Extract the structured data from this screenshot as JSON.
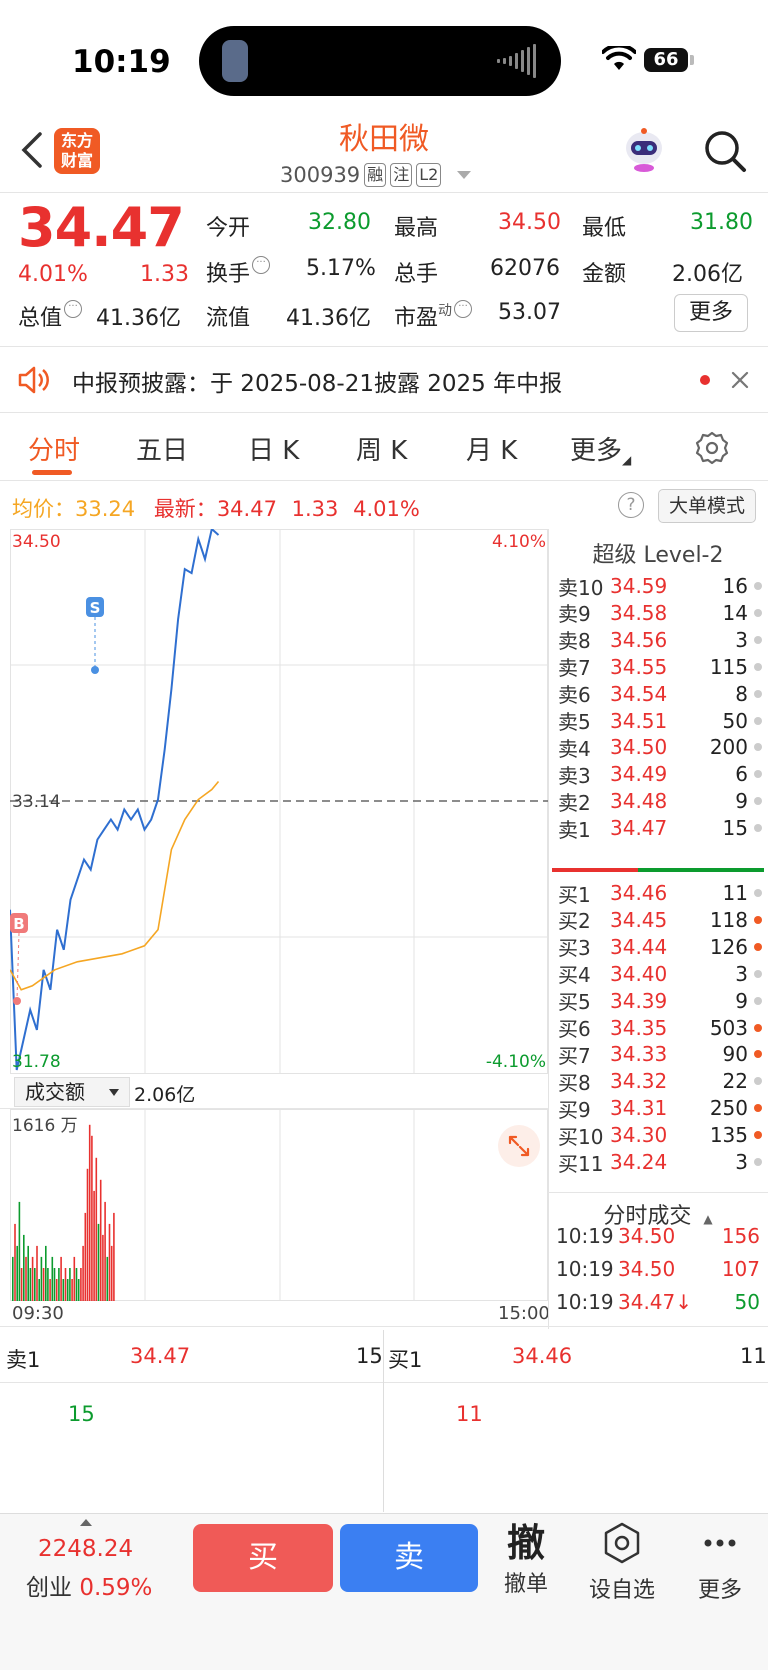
{
  "status": {
    "time": "10:19",
    "battery": "66"
  },
  "header": {
    "logo_line1": "东方",
    "logo_line2": "财富",
    "stock_name": "秋田微",
    "stock_code": "300939",
    "tags": [
      "融",
      "注",
      "L2"
    ]
  },
  "quote": {
    "price": "34.47",
    "change_pct": "4.01%",
    "change": "1.33",
    "open_label": "今开",
    "open": "32.80",
    "high_label": "最高",
    "high": "34.50",
    "low_label": "最低",
    "low": "31.80",
    "turnover_label": "换手",
    "turnover": "5.17%",
    "volume_label": "总手",
    "volume": "62076",
    "amount_label": "金额",
    "amount": "2.06亿",
    "mktcap_label": "总值",
    "mktcap": "41.36亿",
    "float_label": "流值",
    "float": "41.36亿",
    "pe_label": "市盈",
    "pe_sup": "动",
    "pe": "53.07",
    "more": "更多"
  },
  "notice": {
    "text": "中报预披露：于 2025-08-21披露 2025 年中报"
  },
  "tabs": [
    "分时",
    "五日",
    "日 K",
    "周 K",
    "月 K",
    "更多"
  ],
  "avg_row": {
    "avg_label": "均价：",
    "avg": "33.24",
    "latest_label": "最新：",
    "latest": "34.47",
    "latest_chg": "1.33",
    "latest_pct": "4.01%",
    "help": "?",
    "big_order": "大单模式"
  },
  "chart": {
    "y_max": "34.50",
    "y_min": "31.78",
    "pct_max": "4.10%",
    "pct_min": "-4.10%",
    "prev_close": "33.14",
    "marker_s": "S",
    "marker_b": "B",
    "volume_selector": "成交额",
    "volume_total": "2.06亿",
    "volume_max": "1616 万",
    "time_start": "09:30",
    "time_end": "15:00"
  },
  "chart_data": {
    "type": "line",
    "ylim": [
      31.78,
      34.5
    ],
    "prev_close": 33.14,
    "series": [
      {
        "points": [
          [
            0,
            32.6
          ],
          [
            3,
            31.8
          ],
          [
            6,
            31.95
          ],
          [
            9,
            32.1
          ],
          [
            12,
            32.0
          ],
          [
            15,
            32.3
          ],
          [
            18,
            32.2
          ],
          [
            21,
            32.5
          ],
          [
            24,
            32.4
          ],
          [
            27,
            32.65
          ],
          [
            30,
            32.75
          ],
          [
            33,
            32.85
          ],
          [
            36,
            32.8
          ],
          [
            39,
            32.95
          ],
          [
            42,
            33.0
          ],
          [
            45,
            33.05
          ],
          [
            48,
            33.0
          ],
          [
            51,
            33.1
          ],
          [
            54,
            33.05
          ],
          [
            57,
            33.1
          ],
          [
            60,
            33.0
          ],
          [
            63,
            33.05
          ],
          [
            66,
            33.15
          ],
          [
            69,
            33.4
          ],
          [
            72,
            33.7
          ],
          [
            75,
            34.05
          ],
          [
            78,
            34.3
          ],
          [
            81,
            34.28
          ],
          [
            84,
            34.45
          ],
          [
            87,
            34.35
          ],
          [
            90,
            34.5
          ],
          [
            93,
            34.47
          ]
        ]
      },
      {
        "points": [
          [
            0,
            32.3
          ],
          [
            5,
            32.2
          ],
          [
            10,
            32.22
          ],
          [
            20,
            32.3
          ],
          [
            30,
            32.34
          ],
          [
            40,
            32.36
          ],
          [
            50,
            32.38
          ],
          [
            60,
            32.42
          ],
          [
            66,
            32.5
          ],
          [
            72,
            32.9
          ],
          [
            78,
            33.05
          ],
          [
            84,
            33.15
          ],
          [
            90,
            33.2
          ],
          [
            93,
            33.24
          ]
        ]
      }
    ],
    "volume": {
      "max": 16.16,
      "bars": [
        [
          4,
          "g"
        ],
        [
          7,
          "r"
        ],
        [
          5,
          "g"
        ],
        [
          9,
          "g"
        ],
        [
          3,
          "r"
        ],
        [
          6,
          "g"
        ],
        [
          4,
          "r"
        ],
        [
          5,
          "g"
        ],
        [
          3,
          "g"
        ],
        [
          4,
          "r"
        ],
        [
          3,
          "g"
        ],
        [
          5,
          "r"
        ],
        [
          2,
          "g"
        ],
        [
          4,
          "g"
        ],
        [
          3,
          "r"
        ],
        [
          5,
          "g"
        ],
        [
          3,
          "g"
        ],
        [
          2,
          "r"
        ],
        [
          4,
          "g"
        ],
        [
          3,
          "g"
        ],
        [
          2,
          "r"
        ],
        [
          3,
          "g"
        ],
        [
          4,
          "r"
        ],
        [
          2,
          "g"
        ],
        [
          3,
          "r"
        ],
        [
          2,
          "g"
        ],
        [
          3,
          "g"
        ],
        [
          2,
          "r"
        ],
        [
          4,
          "r"
        ],
        [
          3,
          "g"
        ],
        [
          2,
          "g"
        ],
        [
          3,
          "r"
        ],
        [
          5,
          "r"
        ],
        [
          8,
          "r"
        ],
        [
          12,
          "r"
        ],
        [
          16,
          "r"
        ],
        [
          15,
          "r"
        ],
        [
          10,
          "r"
        ],
        [
          13,
          "r"
        ],
        [
          7,
          "g"
        ],
        [
          11,
          "r"
        ],
        [
          6,
          "r"
        ],
        [
          9,
          "r"
        ],
        [
          4,
          "g"
        ],
        [
          7,
          "r"
        ],
        [
          5,
          "r"
        ],
        [
          8,
          "r"
        ]
      ]
    }
  },
  "order_book": {
    "title": "超级 Level-2",
    "asks": [
      {
        "label": "卖10",
        "price": "34.59",
        "vol": "16",
        "hot": false
      },
      {
        "label": "卖9",
        "price": "34.58",
        "vol": "14",
        "hot": false
      },
      {
        "label": "卖8",
        "price": "34.56",
        "vol": "3",
        "hot": false
      },
      {
        "label": "卖7",
        "price": "34.55",
        "vol": "115",
        "hot": false
      },
      {
        "label": "卖6",
        "price": "34.54",
        "vol": "8",
        "hot": false
      },
      {
        "label": "卖5",
        "price": "34.51",
        "vol": "50",
        "hot": false
      },
      {
        "label": "卖4",
        "price": "34.50",
        "vol": "200",
        "hot": false
      },
      {
        "label": "卖3",
        "price": "34.49",
        "vol": "6",
        "hot": false
      },
      {
        "label": "卖2",
        "price": "34.48",
        "vol": "9",
        "hot": false
      },
      {
        "label": "卖1",
        "price": "34.47",
        "vol": "15",
        "hot": false
      }
    ],
    "bids": [
      {
        "label": "买1",
        "price": "34.46",
        "vol": "11",
        "hot": false
      },
      {
        "label": "买2",
        "price": "34.45",
        "vol": "118",
        "hot": true
      },
      {
        "label": "买3",
        "price": "34.44",
        "vol": "126",
        "hot": true
      },
      {
        "label": "买4",
        "price": "34.40",
        "vol": "3",
        "hot": false
      },
      {
        "label": "买5",
        "price": "34.39",
        "vol": "9",
        "hot": false
      },
      {
        "label": "买6",
        "price": "34.35",
        "vol": "503",
        "hot": true
      },
      {
        "label": "买7",
        "price": "34.33",
        "vol": "90",
        "hot": true
      },
      {
        "label": "买8",
        "price": "34.32",
        "vol": "22",
        "hot": false
      },
      {
        "label": "买9",
        "price": "34.31",
        "vol": "250",
        "hot": true
      },
      {
        "label": "买10",
        "price": "34.30",
        "vol": "135",
        "hot": true
      },
      {
        "label": "买11",
        "price": "34.24",
        "vol": "3",
        "hot": false
      }
    ],
    "trades_title": "分时成交",
    "trades": [
      {
        "time": "10:19",
        "price": "34.50",
        "vol": "156",
        "side": "buy"
      },
      {
        "time": "10:19",
        "price": "34.50",
        "vol": "107",
        "side": "buy"
      },
      {
        "time": "10:19",
        "price": "34.47↓",
        "vol": "50",
        "side": "sell"
      }
    ]
  },
  "order_strip": {
    "ask_label": "卖1",
    "ask_price": "34.47",
    "ask_vol": "15",
    "ask_detail": "15",
    "bid_label": "买1",
    "bid_price": "34.46",
    "bid_vol": "11",
    "bid_detail": "11"
  },
  "bottom_bar": {
    "index_value": "2248.24",
    "index_name": "创业",
    "index_pct": "0.59%",
    "buy": "买",
    "sell": "卖",
    "cancel_glyph": "撤",
    "cancel": "撤单",
    "watchlist": "设自选",
    "more": "更多"
  },
  "colors": {
    "up": "#e8312f",
    "down": "#0c9b2e",
    "accent": "#f05a24",
    "price_line": "#2f6fd0",
    "avg_line": "#f5a623",
    "buy_btn": "#f05a57",
    "sell_btn": "#3b7ff2"
  }
}
